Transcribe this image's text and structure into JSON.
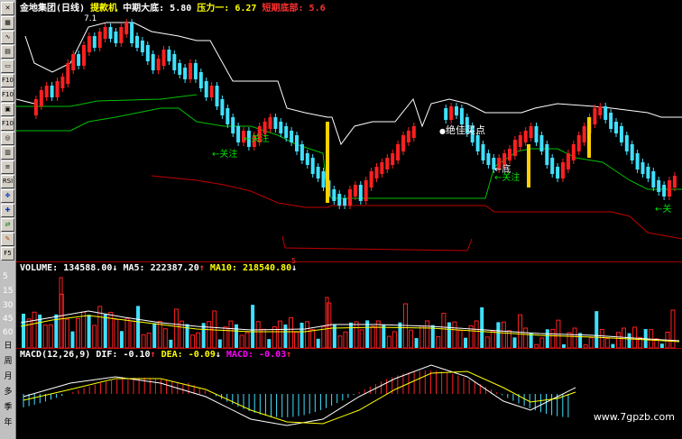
{
  "header": {
    "stock_name": "金地集团",
    "period": "(日线)",
    "indicator": "提款机",
    "support_label": "中期大底:",
    "support_value": "5.80",
    "resistance_label": "压力一:",
    "resistance_value": "6.27",
    "short_label": "短期底部:",
    "short_value": "5.6"
  },
  "price_panel": {
    "high_marker": "7.1",
    "low_marker": "5",
    "annotations": {
      "best_buy": "绝佳买点",
      "focus1": "←关注",
      "focus2": "←关注",
      "bottom": "←底",
      "focus3": "←关注",
      "focus4": "←关"
    }
  },
  "volume_panel": {
    "label": "VOLUME:",
    "volume": "134588.00",
    "ma5_label": "MA5:",
    "ma5": "222387.20",
    "ma10_label": "MA10:",
    "ma10": "218540.80",
    "axis": [
      "5",
      "15",
      "30",
      "45",
      "60"
    ]
  },
  "macd_panel": {
    "label": "MACD(12,26,9)",
    "dif_label": "DIF:",
    "dif": "-0.10",
    "dea_label": "DEA:",
    "dea": "-0.09",
    "macd_label": "MACD:",
    "macd": "-0.03"
  },
  "toolbar": {
    "buttons": [
      "",
      "",
      " ",
      "F10",
      "F10",
      "",
      "F10",
      "",
      "",
      "F12",
      "F10",
      "",
      "",
      " ",
      "RSI",
      "",
      "",
      "",
      "F5"
    ],
    "period_labels": [
      "日",
      "周",
      "月",
      "多",
      "季",
      "年"
    ]
  },
  "watermark": "www.7gpzb.com",
  "colors": {
    "up": "#ff2020",
    "down": "#40e0ff",
    "resistance": "#ffffff",
    "support": "#00c000",
    "floor": "#c00000",
    "highlight": "#ffd000"
  }
}
